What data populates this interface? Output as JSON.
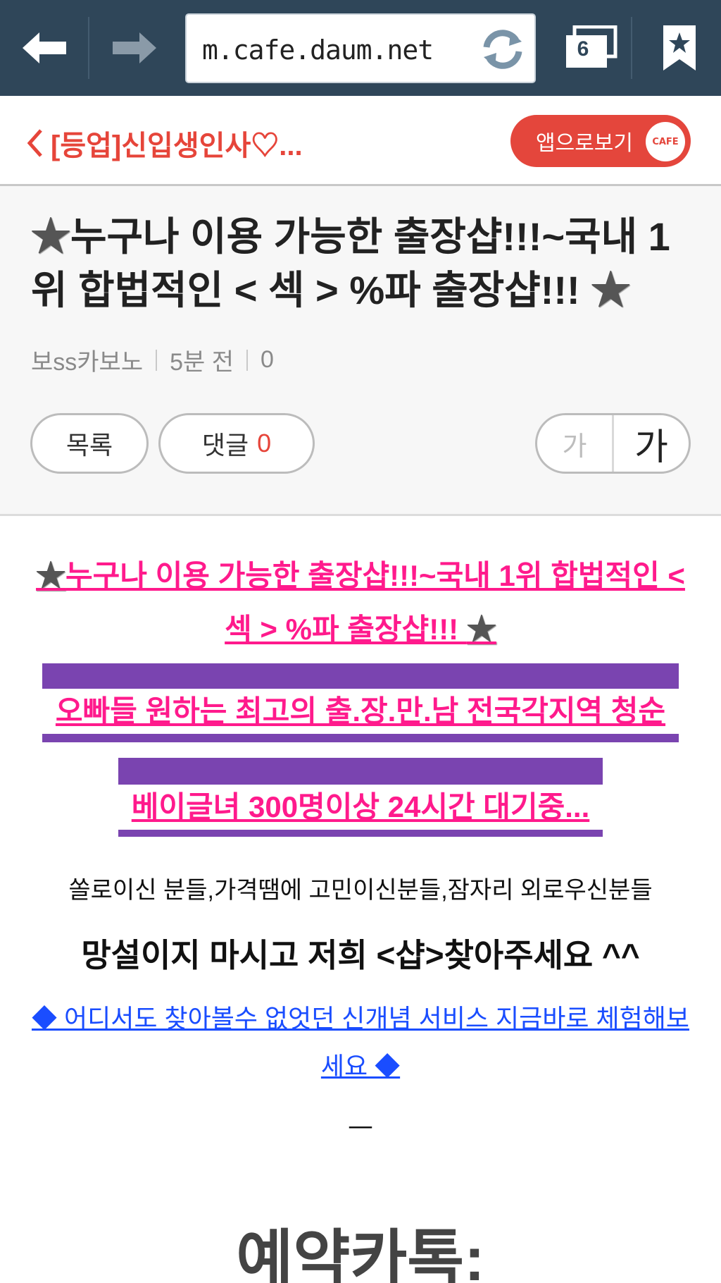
{
  "browser": {
    "url": "m.cafe.daum.net",
    "tab_count": "6",
    "icons": [
      "back-arrow-icon",
      "forward-arrow-icon",
      "reload-icon",
      "tabs-icon",
      "bookmark-star-icon"
    ]
  },
  "cafe_header": {
    "cafe_name": "[등업]신입생인사♡...",
    "app_button_label": "앱으로보기",
    "app_logo_text": "CAFE"
  },
  "article": {
    "title": "누구나 이용 가능한 출장샵!!!~국내 1위 합법적인  < 섹 > %파 출장샵!!! ",
    "author": "보ss카보노",
    "time": "5분 전",
    "views": "0",
    "list_label": "목록",
    "comment_label": "댓글",
    "comment_count": "0",
    "font_small": "가",
    "font_large": "가"
  },
  "body": {
    "pink_title": "누구나 이용 가능한 출장샵!!!~국내 1위 합법적인  < 섹 > %파 출장샵!!! ",
    "purple_line_1": "오빠들 원하는 최고의 출.장.만.남 전국각지역 청순",
    "purple_line_2": "베이글녀 300명이상 24시간 대기중...",
    "line_small": "쏠로이신 분들,가격땜에 고민이신분들,잠자리 외로우신분들",
    "line_large": "망설이지 마시고 저희 <샵>찾아주세요 ^^",
    "blue_link": "◆ 어디서도 찾아볼수 없엇던 신개념 서비스 지금바로 체험해보세요 ◆",
    "dash": "—",
    "big_heading": "예약카톡:"
  },
  "colors": {
    "toolbar_bg": "#2f4659",
    "accent_red": "#e6453a",
    "pink_text": "#ff1a8c",
    "purple_block": "#7a44b0",
    "blue_link": "#1a4dff"
  }
}
